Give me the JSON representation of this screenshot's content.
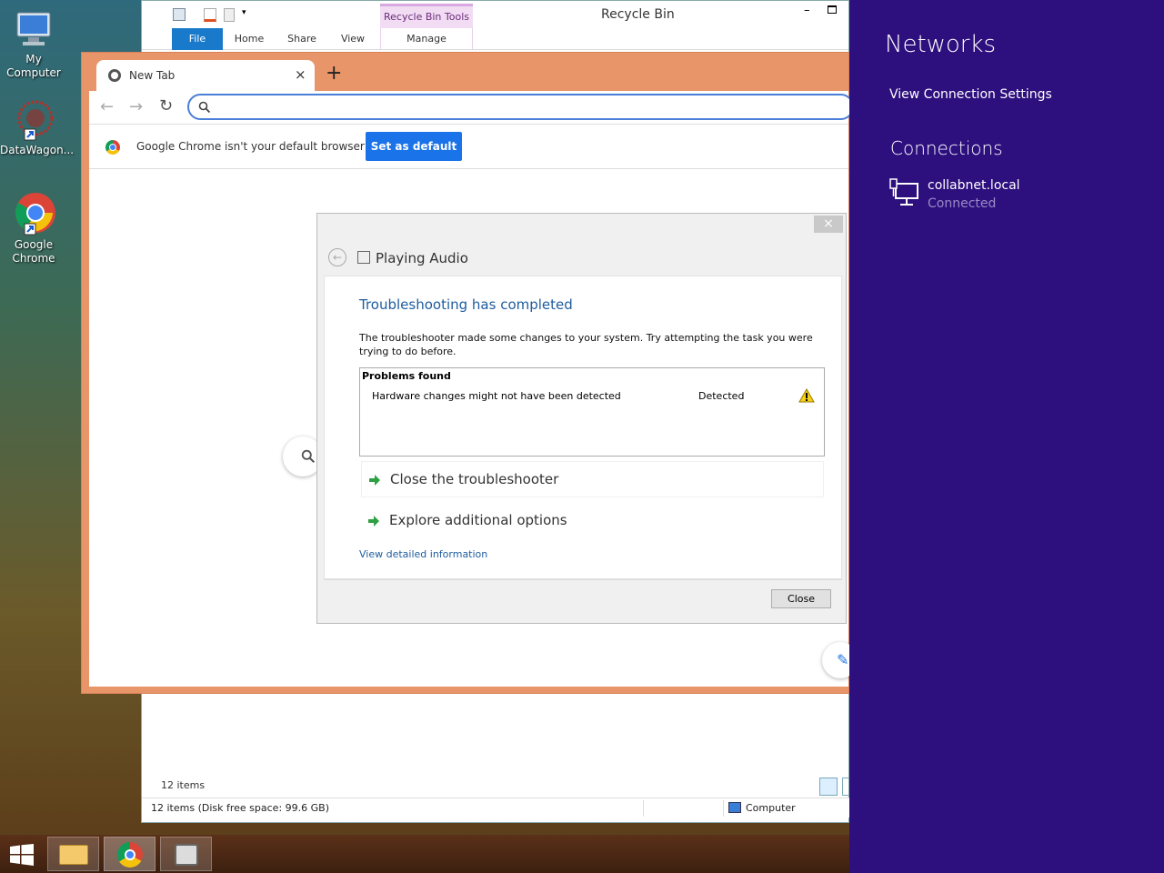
{
  "desktop": {
    "icons": [
      {
        "label": "My Computer"
      },
      {
        "label": "DataWagon..."
      },
      {
        "label": "Google Chrome"
      }
    ]
  },
  "explorer": {
    "title": "Recycle Bin",
    "contextual_tab_group": "Recycle Bin Tools",
    "tabs": [
      "File",
      "Home",
      "Share",
      "View",
      "Manage"
    ],
    "items_count": "12 items",
    "status_text": "12 items (Disk free space: 99.6 GB)",
    "status_location": "Computer"
  },
  "chrome": {
    "tab_title": "New Tab",
    "omnibox_placeholder": "",
    "infobar_text": "Google Chrome isn't your default browser",
    "set_default_label": "Set as default"
  },
  "troubleshooter": {
    "header_title": "Playing Audio",
    "heading": "Troubleshooting has completed",
    "description": "The troubleshooter made some changes to your system. Try attempting the task you were trying to do before.",
    "problems_title": "Problems found",
    "problems": [
      {
        "name": "Hardware changes might not have been detected",
        "status": "Detected"
      }
    ],
    "close_option": "Close the troubleshooter",
    "explore_option": "Explore additional options",
    "details_link": "View detailed information",
    "close_button": "Close"
  },
  "networks": {
    "title": "Networks",
    "view_settings": "View Connection Settings",
    "connections_title": "Connections",
    "connection_name": "collabnet.local",
    "connection_status": "Connected"
  },
  "colors": {
    "charm_bg": "#2d0f7e",
    "chrome_frame": "#e8956a",
    "accent_blue": "#1a73e8",
    "heading_blue": "#1e5c9e"
  }
}
